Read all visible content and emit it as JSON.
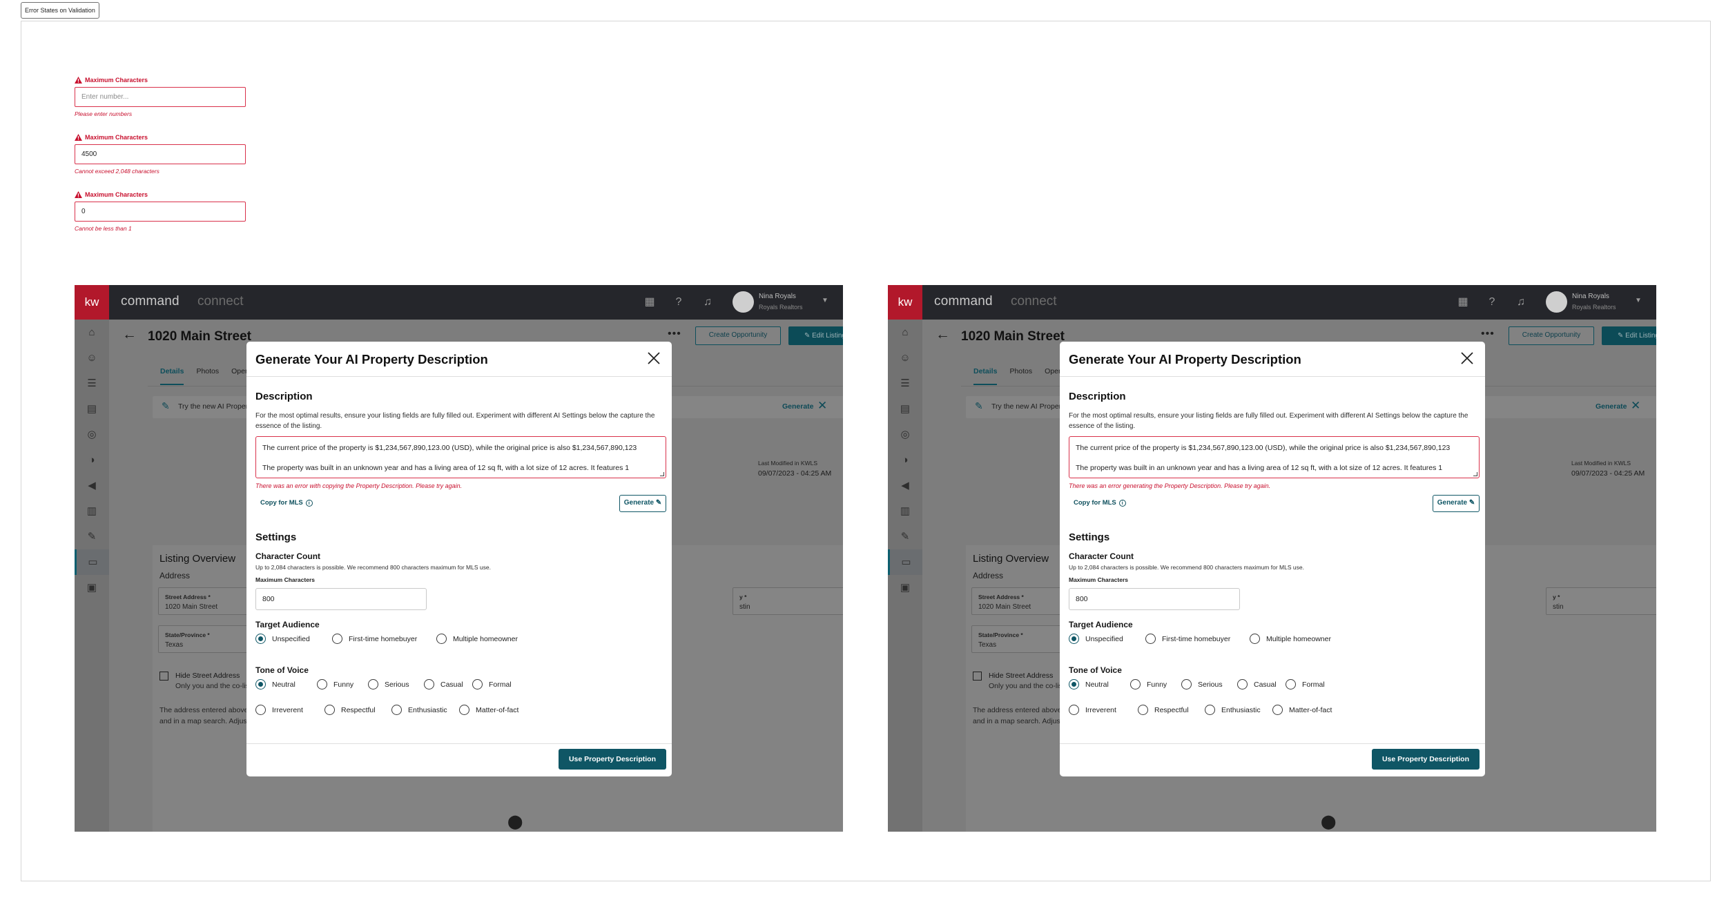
{
  "frame_label": "Error States on Validation",
  "error_fields": [
    {
      "label": "Maximum Characters",
      "value": "",
      "placeholder": "Enter number...",
      "error": "Please enter numbers"
    },
    {
      "label": "Maximum Characters",
      "value": "4500",
      "placeholder": "",
      "error": "Cannot exceed 2,048 characters"
    },
    {
      "label": "Maximum Characters",
      "value": "0",
      "placeholder": "",
      "error": "Cannot be less than 1"
    }
  ],
  "colors": {
    "error": "#c8102e",
    "brand_teal": "#0f5665",
    "topbar": "#25262b",
    "kw_red": "#b2182b"
  },
  "apps": [
    {
      "topbar": {
        "logo": "kw",
        "brand": "command",
        "brand2": "connect",
        "user_name": "Nina Royals",
        "user_org": "Royals Realtors"
      },
      "page": {
        "title": "1020 Main Street",
        "create_btn": "Create Opportunity",
        "edit_btn": "Edit Listing",
        "tabs": [
          "Details",
          "Photos",
          "Open House"
        ]
      },
      "banner": {
        "text": "Try the new AI Property Desc",
        "action": "Generate"
      },
      "summary": {
        "price_stub": "$",
        "modified_label": "Last Modified in KWLS",
        "modified_date": "09/07/2023 - 04:25 AM"
      },
      "overview": {
        "title": "Listing Overview",
        "address_label": "Address",
        "street_label": "Street Address *",
        "street_value": "1020 Main Street",
        "city_label_stub": "y *",
        "city_value_stub": "stin",
        "state_label": "State/Province *",
        "state_value": "Texas",
        "hide_label": "Hide Street Address",
        "hide_sub": "Only you and the co-listing ag",
        "para1": "The address entered above is indic",
        "para2": "and in a map search. Adjusting the"
      },
      "modal": {
        "title": "Generate Your AI Property Description",
        "description_heading": "Description",
        "description_help": "For the most optimal results, ensure your listing fields are fully filled out. Experiment with different AI Settings below the capture the essence of the listing.",
        "text_line1": "The current price of the property is $1,234,567,890,123.00 (USD), while the original price is also $1,234,567,890,123",
        "text_line2": "The property was built in an unknown year and has a living area of 12 sq ft, with a lot size of 12 acres. It features 1",
        "error": "There was an error with copying the Property Description. Please try again.",
        "copy_label": "Copy for MLS",
        "generate_label": "Generate",
        "settings_heading": "Settings",
        "char_count_heading": "Character Count",
        "char_count_help": "Up to 2,084 characters is possible. We recommend 800 characters maximum for MLS use.",
        "max_label": "Maximum Characters",
        "max_value": "800",
        "audience_heading": "Target Audience",
        "audience_options": [
          "Unspecified",
          "First-time homebuyer",
          "Multiple homeowner"
        ],
        "tone_heading": "Tone of Voice",
        "tone_row1": [
          "Neutral",
          "Funny",
          "Serious",
          "Casual",
          "Formal"
        ],
        "tone_row2": [
          "Irreverent",
          "Respectful",
          "Enthusiastic",
          "Matter-of-fact"
        ],
        "use_btn": "Use Property Description"
      }
    },
    {
      "topbar": {
        "logo": "kw",
        "brand": "command",
        "brand2": "connect",
        "user_name": "Nina Royals",
        "user_org": "Royals Realtors"
      },
      "page": {
        "title": "1020 Main Street",
        "create_btn": "Create Opportunity",
        "edit_btn": "Edit Listing",
        "tabs": [
          "Details",
          "Photos",
          "Open House"
        ]
      },
      "banner": {
        "text": "Try the new AI Property Desc",
        "action": "Generate"
      },
      "summary": {
        "price_stub": "$",
        "modified_label": "Last Modified in KWLS",
        "modified_date": "09/07/2023 - 04:25 AM"
      },
      "overview": {
        "title": "Listing Overview",
        "address_label": "Address",
        "street_label": "Street Address *",
        "street_value": "1020 Main Street",
        "city_label_stub": "y *",
        "city_value_stub": "stin",
        "state_label": "State/Province *",
        "state_value": "Texas",
        "hide_label": "Hide Street Address",
        "hide_sub": "Only you and the co-listing ag",
        "para1": "The address entered above is indic",
        "para2": "and in a map search. Adjusting the"
      },
      "modal": {
        "title": "Generate Your AI Property Description",
        "description_heading": "Description",
        "description_help": "For the most optimal results, ensure your listing fields are fully filled out. Experiment with different AI Settings below the capture the essence of the listing.",
        "text_line1": "The current price of the property is $1,234,567,890,123.00 (USD), while the original price is also $1,234,567,890,123",
        "text_line2": "The property was built in an unknown year and has a living area of 12 sq ft, with a lot size of 12 acres. It features 1",
        "error": "There was an error generating the Property Description. Please try again.",
        "copy_label": "Copy for MLS",
        "generate_label": "Generate",
        "settings_heading": "Settings",
        "char_count_heading": "Character Count",
        "char_count_help": "Up to 2,084 characters is possible. We recommend 800 characters maximum for MLS use.",
        "max_label": "Maximum Characters",
        "max_value": "800",
        "audience_heading": "Target Audience",
        "audience_options": [
          "Unspecified",
          "First-time homebuyer",
          "Multiple homeowner"
        ],
        "tone_heading": "Tone of Voice",
        "tone_row1": [
          "Neutral",
          "Funny",
          "Serious",
          "Casual",
          "Formal"
        ],
        "tone_row2": [
          "Irreverent",
          "Respectful",
          "Enthusiastic",
          "Matter-of-fact"
        ],
        "use_btn": "Use Property Description"
      }
    }
  ]
}
